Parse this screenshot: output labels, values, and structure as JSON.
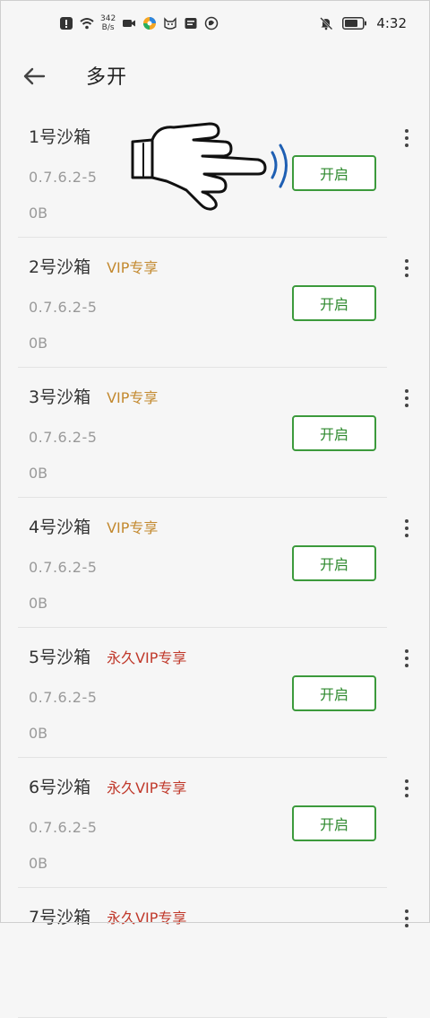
{
  "status_bar": {
    "net_speed_value": "342",
    "net_speed_unit": "B/s",
    "time": "4:32",
    "icons": [
      "alert-icon",
      "wifi-icon",
      "video-icon",
      "app-icon",
      "cat-icon",
      "notes-icon",
      "browser-icon",
      "mute-icon",
      "battery-icon"
    ]
  },
  "header": {
    "title": "多开"
  },
  "sandboxes": [
    {
      "name": "1号沙箱",
      "badge": "",
      "badge_type": "",
      "version": "0.7.6.2-5",
      "size": "0B",
      "button": "开启"
    },
    {
      "name": "2号沙箱",
      "badge": "VIP专享",
      "badge_type": "vip",
      "version": "0.7.6.2-5",
      "size": "0B",
      "button": "开启"
    },
    {
      "name": "3号沙箱",
      "badge": "VIP专享",
      "badge_type": "vip",
      "version": "0.7.6.2-5",
      "size": "0B",
      "button": "开启"
    },
    {
      "name": "4号沙箱",
      "badge": "VIP专享",
      "badge_type": "vip",
      "version": "0.7.6.2-5",
      "size": "0B",
      "button": "开启"
    },
    {
      "name": "5号沙箱",
      "badge": "永久VIP专享",
      "badge_type": "forever",
      "version": "0.7.6.2-5",
      "size": "0B",
      "button": "开启"
    },
    {
      "name": "6号沙箱",
      "badge": "永久VIP专享",
      "badge_type": "forever",
      "version": "0.7.6.2-5",
      "size": "0B",
      "button": "开启"
    },
    {
      "name": "7号沙箱",
      "badge": "永久VIP专享",
      "badge_type": "forever",
      "version": "",
      "size": "",
      "button": ""
    }
  ],
  "colors": {
    "accent_green": "#3c9a3c",
    "vip_gold": "#c3892f",
    "forever_red": "#c0392b"
  }
}
